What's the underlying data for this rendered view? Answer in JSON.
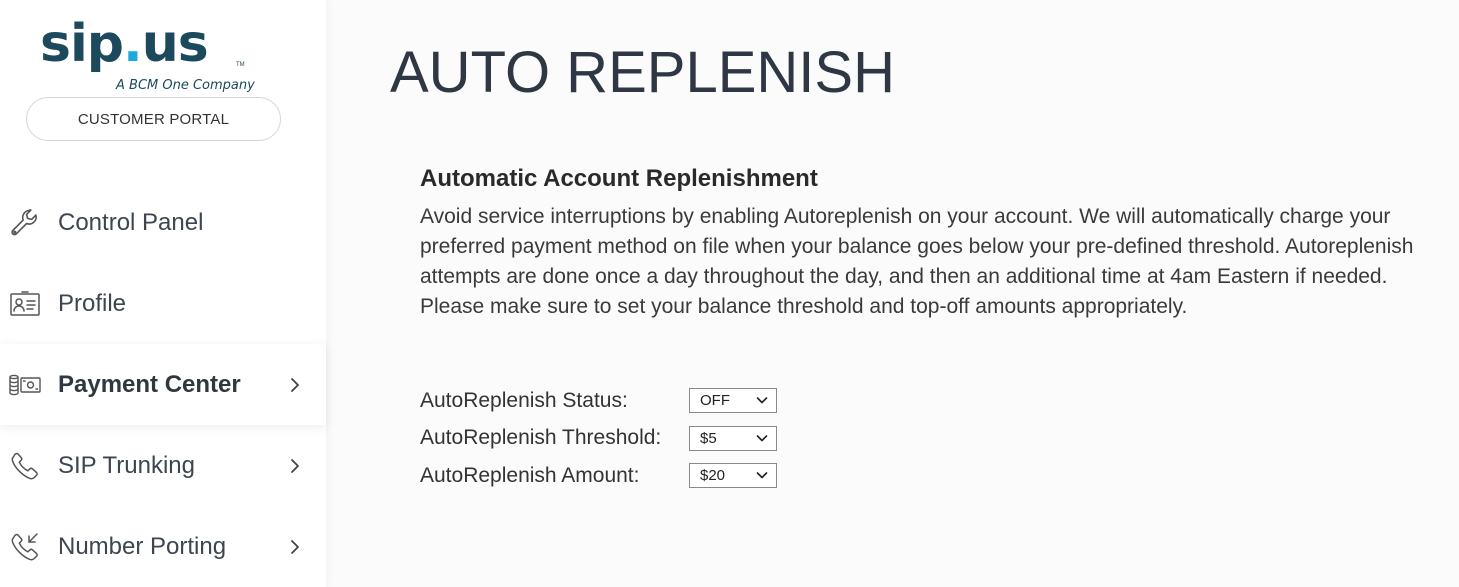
{
  "brand": {
    "logo_main_dark": "sip",
    "logo_dot": ".",
    "logo_main_accent": "us",
    "logo_tm": "TM",
    "logo_sub": "A BCM One Company",
    "portal_label": "CUSTOMER PORTAL",
    "colors": {
      "dark": "#1c4a5c",
      "accent": "#1fa8df"
    }
  },
  "sidebar": {
    "items": [
      {
        "label": "Control Panel",
        "icon": "wrench-icon",
        "active": false,
        "has_chevron": false
      },
      {
        "label": "Profile",
        "icon": "id-card-icon",
        "active": false,
        "has_chevron": false
      },
      {
        "label": "Payment Center",
        "icon": "payment-icon",
        "active": true,
        "has_chevron": true
      },
      {
        "label": "SIP Trunking",
        "icon": "phone-icon",
        "active": false,
        "has_chevron": true
      },
      {
        "label": "Number Porting",
        "icon": "phone-incoming-icon",
        "active": false,
        "has_chevron": true
      }
    ],
    "chevron_glyph": "›"
  },
  "main": {
    "title": "AUTO REPLENISH",
    "section_title": "Automatic Account Replenishment",
    "section_desc": "Avoid service interruptions by enabling Autoreplenish on your account. We will automatically charge your preferred payment method on file when your balance goes below your pre-defined threshold. Autoreplenish attempts are done once a day throughout the day, and then an additional time at 4am Eastern if needed. Please make sure to set your balance threshold and top-off amounts appropriately.",
    "form": {
      "status": {
        "label": "AutoReplenish Status:",
        "value": "OFF"
      },
      "threshold": {
        "label": "AutoReplenish Threshold:",
        "value": "$5"
      },
      "amount": {
        "label": "AutoReplenish Amount:",
        "value": "$20"
      }
    }
  }
}
